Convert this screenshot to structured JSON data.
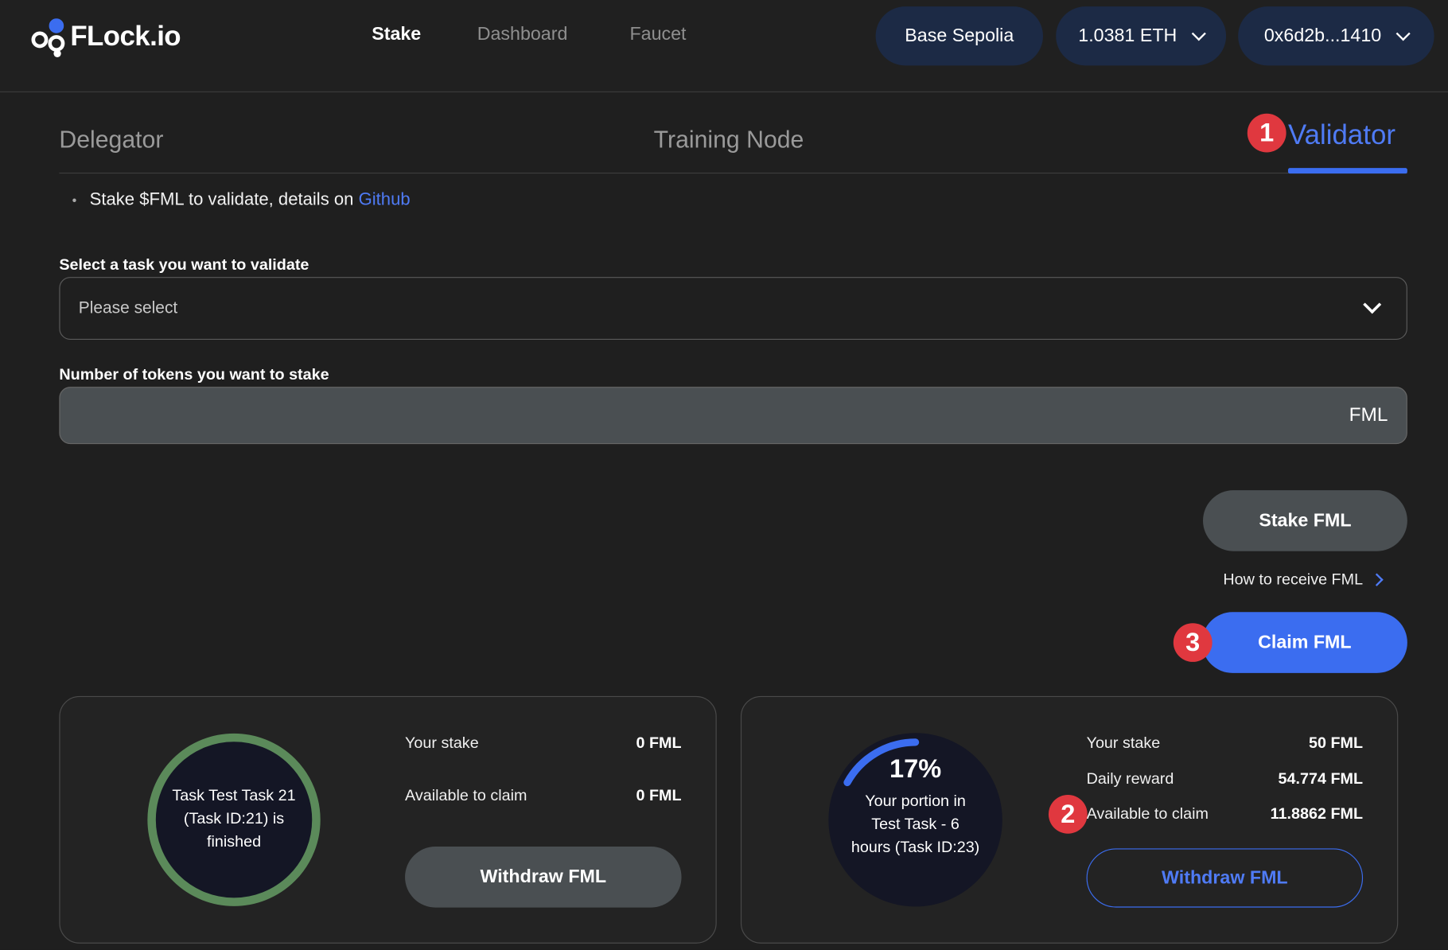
{
  "header": {
    "logo_text": "FLock.io",
    "nav": [
      {
        "label": "Stake"
      },
      {
        "label": "Dashboard"
      },
      {
        "label": "Faucet"
      }
    ],
    "network_label": "Base Sepolia",
    "balance_label": "1.0381 ETH",
    "address_label": "0x6d2b...1410"
  },
  "tabs": [
    {
      "label": "Delegator"
    },
    {
      "label": "Training Node"
    },
    {
      "label": "Validator"
    }
  ],
  "annotations": [
    "1",
    "2",
    "3"
  ],
  "intro": {
    "text": "Stake $FML to validate, details on ",
    "link": "Github"
  },
  "form": {
    "task_label": "Select a task you want to validate",
    "task_placeholder": "Please select",
    "amount_label": "Number of tokens you want to stake",
    "amount_value": "",
    "amount_unit": "FML",
    "stake_button": "Stake FML",
    "howto_link": "How to receive FML",
    "claim_button": "Claim FML"
  },
  "cards": [
    {
      "ring_text": "Task Test Task 21 (Task ID:21) is finished",
      "ring_color": "#5b8a5a",
      "stats": [
        {
          "label": "Your stake",
          "value": "0 FML"
        },
        {
          "label": "Available to claim",
          "value": "0 FML"
        }
      ],
      "withdraw_label": "Withdraw FML"
    },
    {
      "percent_label": "17%",
      "percent": 0.17,
      "ring_text": "Your portion in Test Task - 6 hours (Task ID:23)",
      "ring_color": "#3b6df0",
      "stats": [
        {
          "label": "Your stake",
          "value": "50 FML"
        },
        {
          "label": "Daily reward",
          "value": "54.774 FML"
        },
        {
          "label": "Available to claim",
          "value": "11.8862 FML"
        }
      ],
      "withdraw_label": "Withdraw FML"
    }
  ]
}
